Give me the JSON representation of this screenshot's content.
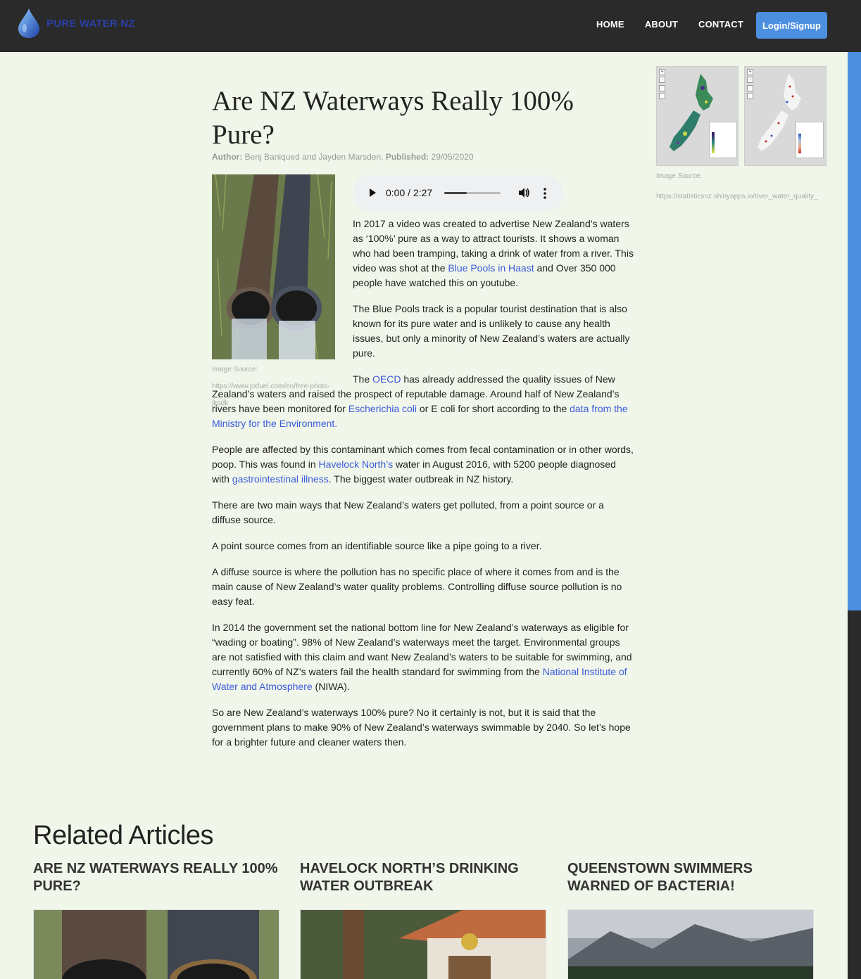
{
  "nav": {
    "logo_text": "PURE WATER NZ",
    "links": [
      "HOME",
      "ABOUT",
      "CONTACT"
    ],
    "login_label": "Login/Signup"
  },
  "article": {
    "title": "Are NZ Waterways Really 100% Pure?",
    "author_label": "Author:",
    "author": "Benj Baniqued and Jayden Marsden,",
    "published_label": "Published:",
    "published": "29/05/2020",
    "image_source_label": "Image Source:",
    "image_source_url": "https://www.pxfuel.com/en/free-photo-jkqdk",
    "audio": {
      "time": "0:00 / 2:27",
      "progress": 0.0
    },
    "p1": {
      "a": "In 2017 a video was created to advertise New Zealand’s waters as ‘100%’ pure as a way to attract tourists. It shows a woman who had been tramping, taking a drink of water from a river. This video was shot at the ",
      "link": "Blue Pools in Haast",
      "b": " and Over 350 000 people have watched this on youtube."
    },
    "p2": "The Blue Pools track is a popular tourist destination that is also known for its pure water and is unlikely to cause any health issues, but only a minority of New Zealand’s waters are actually pure.",
    "p3": {
      "a": "The ",
      "link1": "OECD",
      "b": " has already addressed the quality issues of New Zealand’s waters and raised the prospect of reputable damage. Around half of New Zealand’s rivers have been monitored for ",
      "link2": "Escherichia coli",
      "c": " or E coli for short according to the ",
      "link3": "data from the Ministry for the Environment."
    },
    "p4": {
      "a": "People are affected by this contaminant which comes from fecal contamination or in other words, poop. This was found in ",
      "link1": "Havelock North’s",
      "b": " water in August 2016, with 5200 people diagnosed with ",
      "link2": "gastrointestinal illness",
      "c": ". The biggest water outbreak in NZ history."
    },
    "p5": "There are two main ways that New Zealand’s waters get polluted, from a point source or a diffuse source.",
    "p6": "A point source comes from an identifiable source like a pipe going to a river.",
    "p7": "A diffuse source is where the pollution has no specific place of where it comes from and is the main cause of New Zealand’s water quality problems. Controlling diffuse source pollution is no easy feat.",
    "p8": {
      "a": "In 2014 the government set the national bottom line for New Zealand’s waterways as eligible for “wading or boating”. 98% of New Zealand’s waterways meet the target. Environmental groups are not satisfied with this claim and want New Zealand’s waters to be suitable for swimming, and currently 60% of NZ’s waters fail the health standard for swimming from the ",
      "link": "National Institute of Water and Atmosphere",
      "b": " (NIWA)."
    },
    "p9": "So are New Zealand’s waterways 100% pure? No it certainly is not, but it is said that the government plans to make 90% of New Zealand’s waterways swimmable by 2040. So let’s hope for a brighter future and cleaner waters then."
  },
  "sidebar": {
    "image_source_label": "Image Source:",
    "image_source_url": "https://statisticsnz.shinyapps.io/river_water_quality_"
  },
  "related": {
    "heading": "Related Articles",
    "cards": [
      {
        "title": "ARE NZ WATERWAYS REALLY 100% PURE?"
      },
      {
        "title": "HAVELOCK NORTH’S DRINKING WATER OUTBREAK"
      },
      {
        "title": "QUEENSTOWN SWIMMERS WARNED OF BACTERIA!"
      }
    ]
  },
  "colors": {
    "nav_bg": "#2a2a2a",
    "page_bg": "#f1f6ea",
    "accent": "#4c8fe0",
    "link": "#3b5bdb"
  }
}
